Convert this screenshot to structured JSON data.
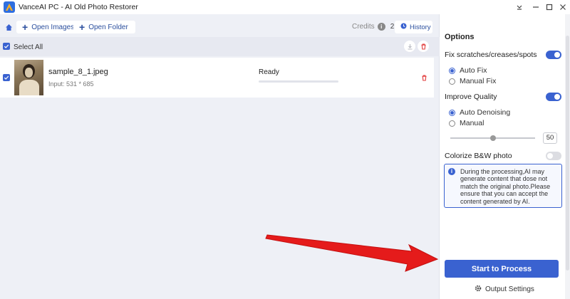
{
  "window": {
    "title": "VanceAI PC - AI Old Photo Restorer"
  },
  "toolbar": {
    "open_images": "Open Images",
    "open_folder": "Open Folder",
    "credits_label": "Credits",
    "credits_count": "2",
    "history": "History"
  },
  "selectbar": {
    "select_all": "Select All"
  },
  "files": [
    {
      "name": "sample_8_1.jpeg",
      "input": "Input: 531 * 685",
      "status": "Ready",
      "progress": 0
    }
  ],
  "options": {
    "title": "Options",
    "fix": {
      "label": "Fix scratches/creases/spots",
      "enabled": true,
      "modes": [
        "Auto Fix",
        "Manual Fix"
      ],
      "selected": "Auto Fix"
    },
    "quality": {
      "label": "Improve Quality",
      "enabled": true,
      "modes": [
        "Auto Denoising",
        "Manual"
      ],
      "selected": "Auto Denoising",
      "slider_value": "50",
      "slider_fraction": 0.5
    },
    "colorize": {
      "label": "Colorize B&W photo",
      "enabled": false
    },
    "notice": "During the processing,AI may generate content that dose not match the original photo.Please ensure that you can accept the content generated by AI.",
    "start_button": "Start to Process",
    "output_settings": "Output Settings"
  },
  "colors": {
    "accent": "#3a62d0",
    "danger": "#e23b3b",
    "arrow": "#e51b1b"
  }
}
